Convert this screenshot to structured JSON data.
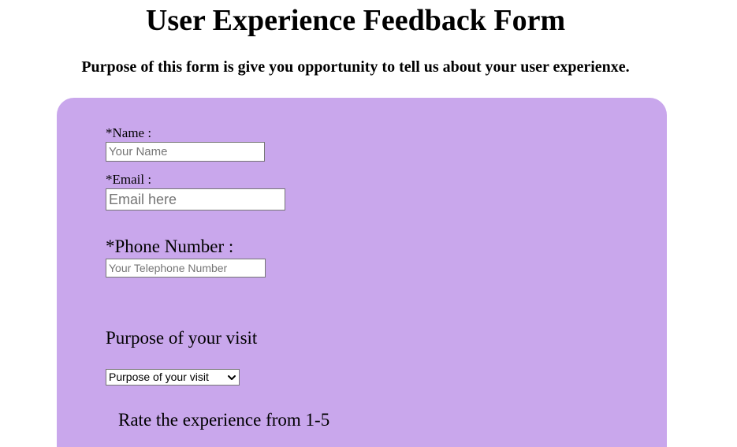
{
  "header": {
    "title": "User Experience Feedback Form",
    "purpose": "Purpose of this form is give you opportunity to tell us about your user experienxe."
  },
  "form": {
    "name": {
      "label": "*Name :",
      "placeholder": "Your Name",
      "value": ""
    },
    "email": {
      "label": "*Email :",
      "placeholder": "Email here",
      "value": ""
    },
    "phone": {
      "label": "*Phone Number :",
      "placeholder": "Your Telephone Number",
      "value": ""
    },
    "visit": {
      "label": "Purpose of your visit",
      "selected": "Purpose of your visit"
    },
    "rating": {
      "label": "Rate the experience from 1-5"
    }
  },
  "icons": {
    "dropdown": "chevron-down-icon"
  },
  "colors": {
    "panel_background": "#c9a7ec",
    "page_background": "#ffffff",
    "text": "#000000",
    "field_border": "#767676"
  }
}
